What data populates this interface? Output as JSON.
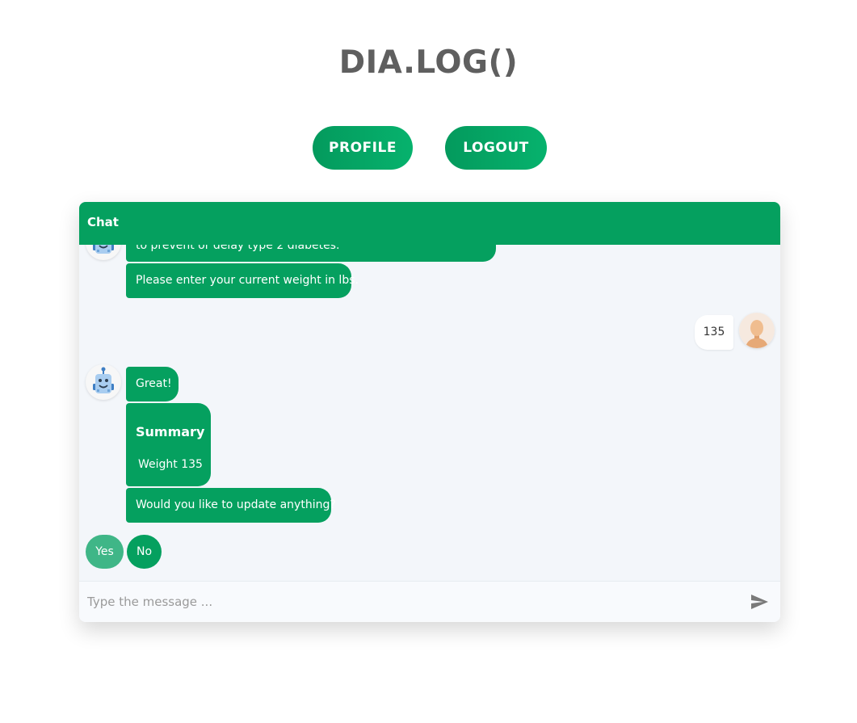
{
  "header": {
    "app_title": "DIA.LOG()",
    "profile_label": "PROFILE",
    "logout_label": "LOGOUT"
  },
  "chat": {
    "title": "Chat",
    "messages": {
      "partial_text": "to prevent or delay type 2 diabetes.",
      "weight_prompt": "Please enter your current weight in lbs.",
      "user_reply": "135",
      "great": "Great!",
      "summary_title": "Summary",
      "summary_line": "Weight 135",
      "update_question": "Would you like to update anything?"
    },
    "quick_replies": {
      "yes": "Yes",
      "no": "No"
    },
    "composer": {
      "placeholder": "Type the message ..."
    }
  },
  "icons": {
    "bot_avatar": "robot-icon",
    "user_avatar": "user-icon",
    "send": "send-icon"
  },
  "colors": {
    "primary_green": "#05a05f",
    "quick_reply_selected": "#3fb687",
    "title_gray": "#5f5f5f",
    "chat_background": "#f3f6fa"
  }
}
